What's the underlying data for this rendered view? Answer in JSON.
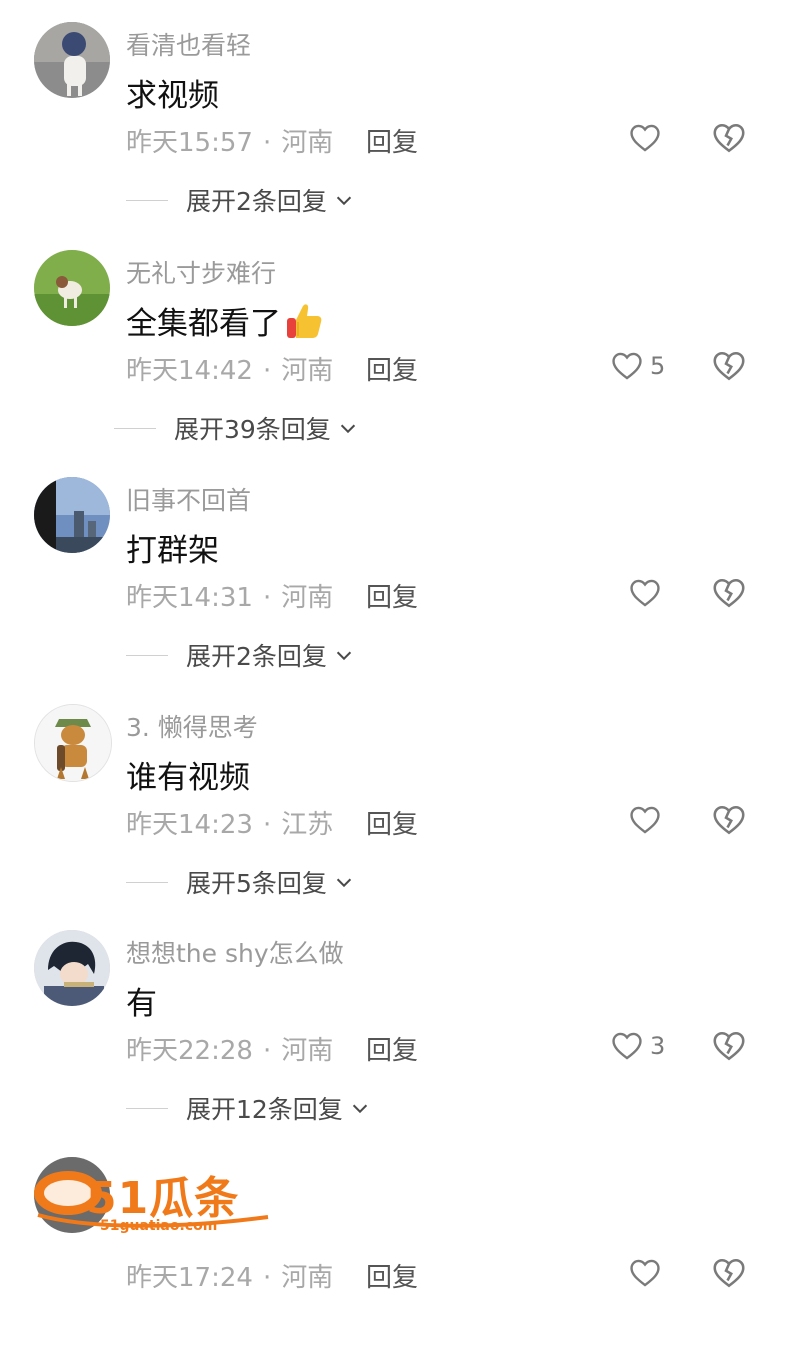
{
  "comments": [
    {
      "username": "看清也看轻",
      "text": "求视频",
      "time": "昨天15:57",
      "location": "河南",
      "reply_label": "回复",
      "likes": "",
      "expand": "展开2条回复"
    },
    {
      "username": "无礼寸步难行",
      "text": "全集都看了",
      "emoji": "thumbs-up",
      "time": "昨天14:42",
      "location": "河南",
      "reply_label": "回复",
      "likes": "5",
      "expand": "展开39条回复"
    },
    {
      "username": "旧事不回首",
      "text": "打群架",
      "time": "昨天14:31",
      "location": "河南",
      "reply_label": "回复",
      "likes": "",
      "expand": "展开2条回复"
    },
    {
      "username": "3. 懒得思考",
      "text": "谁有视频",
      "time": "昨天14:23",
      "location": "江苏",
      "reply_label": "回复",
      "likes": "",
      "expand": "展开5条回复"
    },
    {
      "username": "想想the shy怎么做",
      "text": "有",
      "time": "昨天22:28",
      "location": "河南",
      "reply_label": "回复",
      "likes": "3",
      "expand": "展开12条回复"
    },
    {
      "username": "",
      "text": "",
      "time": "昨天17:24",
      "location": "河南",
      "reply_label": "回复",
      "likes": "",
      "expand": ""
    }
  ],
  "separator": "·",
  "watermark": {
    "brand": "51瓜条",
    "url": "51guatiao.com"
  },
  "colors": {
    "accent": "#f07a1a",
    "meta_text": "#a8a8a8",
    "username": "#9a9a9a"
  }
}
